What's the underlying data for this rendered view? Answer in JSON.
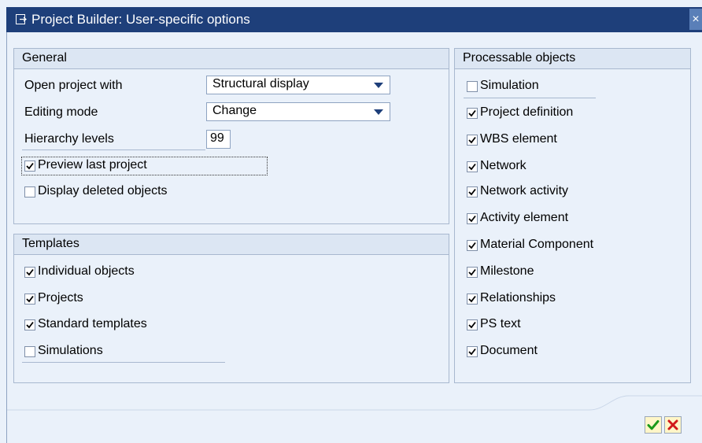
{
  "window": {
    "title": "Project Builder: User-specific options",
    "title_icon": "options-dialog-icon",
    "close_icon": "close-icon",
    "close_glyph": "×"
  },
  "general": {
    "title": "General",
    "fields": [
      {
        "label": "Open project with",
        "value": "Structural display"
      },
      {
        "label": "Editing mode",
        "value": "Change"
      },
      {
        "label": "Hierarchy levels",
        "value": "99"
      }
    ],
    "checkboxes": [
      {
        "label": "Preview last project",
        "checked": true
      },
      {
        "label": "Display deleted objects",
        "checked": false
      }
    ]
  },
  "templates": {
    "title": "Templates",
    "checkboxes": [
      {
        "label": "Individual objects",
        "checked": true
      },
      {
        "label": "Projects",
        "checked": true
      },
      {
        "label": "Standard templates",
        "checked": true
      },
      {
        "label": "Simulations",
        "checked": false
      }
    ]
  },
  "processable": {
    "title": "Processable objects",
    "checkboxes": [
      {
        "label": "Simulation",
        "checked": false
      },
      {
        "label": "Project definition",
        "checked": true
      },
      {
        "label": "WBS element",
        "checked": true
      },
      {
        "label": "Network",
        "checked": true
      },
      {
        "label": "Network activity",
        "checked": true
      },
      {
        "label": "Activity element",
        "checked": true
      },
      {
        "label": "Material Component",
        "checked": true
      },
      {
        "label": "Milestone",
        "checked": true
      },
      {
        "label": "Relationships",
        "checked": true
      },
      {
        "label": "PS text",
        "checked": true
      },
      {
        "label": "Document",
        "checked": true
      }
    ]
  },
  "footer": {
    "confirm_icon": "checkmark-icon",
    "cancel_icon": "cancel-x-icon",
    "colors": {
      "confirm": "#1a9a1a",
      "cancel": "#d11a1a"
    }
  },
  "colors": {
    "titlebar": "#1e3f7a",
    "panel_bg": "#eaf1fa",
    "header_bg": "#dce6f3"
  }
}
